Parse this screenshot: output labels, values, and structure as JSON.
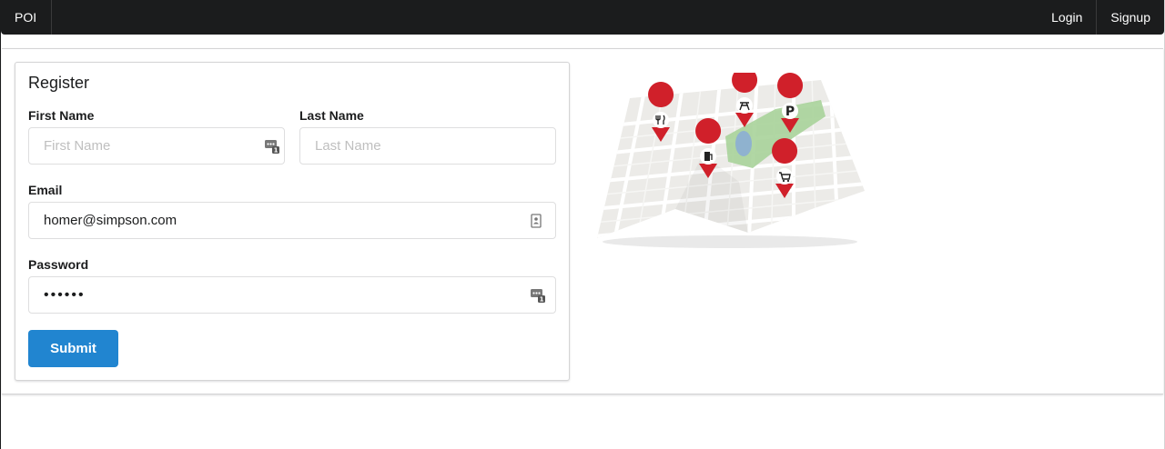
{
  "nav": {
    "brand": "POI",
    "login_label": "Login",
    "signup_label": "Signup"
  },
  "form": {
    "title": "Register",
    "first_name": {
      "label": "First Name",
      "placeholder": "First Name",
      "value": ""
    },
    "last_name": {
      "label": "Last Name",
      "placeholder": "Last Name",
      "value": ""
    },
    "email": {
      "label": "Email",
      "value": "homer@simpson.com"
    },
    "password": {
      "label": "Password",
      "masked_value": "••••••"
    },
    "submit_label": "Submit"
  },
  "colors": {
    "menu_bg": "#1b1c1d",
    "primary": "#2185d0",
    "pin_red": "#d0202a",
    "park_green": "#a9d39a"
  },
  "icons": {
    "first_name_field": "password-manager-icon",
    "email_field": "contact-card-icon",
    "password_field": "password-manager-icon",
    "pins": [
      "restaurant-icon",
      "picnic-icon",
      "parking-icon",
      "fuel-icon",
      "shopping-cart-icon"
    ]
  }
}
